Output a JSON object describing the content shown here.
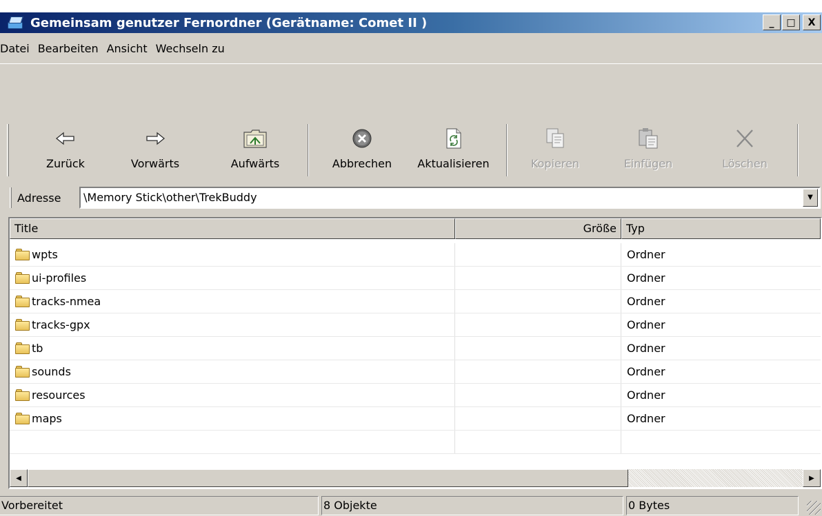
{
  "window": {
    "title": "Gemeinsam genutzer Fernordner (Gerätname: Comet II )",
    "buttons": {
      "minimize": "_",
      "maximize": "□",
      "close": "X"
    }
  },
  "menu": [
    "Datei",
    "Bearbeiten",
    "Ansicht",
    "Wechseln zu"
  ],
  "toolbar": {
    "back": "Zurück",
    "forward": "Vorwärts",
    "up": "Aufwärts",
    "stop": "Abbrechen",
    "refresh": "Aktualisieren",
    "copy": "Kopieren",
    "paste": "Einfügen",
    "delete": "Löschen"
  },
  "address": {
    "label": "Adresse",
    "value": "\\Memory Stick\\other\\TrekBuddy"
  },
  "list": {
    "columns": {
      "title": "Title",
      "size": "Größe",
      "type": "Typ"
    },
    "rows": [
      {
        "name": "wpts",
        "size": "",
        "type": "Ordner"
      },
      {
        "name": "ui-profiles",
        "size": "",
        "type": "Ordner"
      },
      {
        "name": "tracks-nmea",
        "size": "",
        "type": "Ordner"
      },
      {
        "name": "tracks-gpx",
        "size": "",
        "type": "Ordner"
      },
      {
        "name": "tb",
        "size": "",
        "type": "Ordner"
      },
      {
        "name": "sounds",
        "size": "",
        "type": "Ordner"
      },
      {
        "name": "resources",
        "size": "",
        "type": "Ordner"
      },
      {
        "name": "maps",
        "size": "",
        "type": "Ordner"
      }
    ]
  },
  "status": {
    "state": "Vorbereitet",
    "count": "8 Objekte",
    "bytes": "0 Bytes"
  },
  "colors": {
    "title_gradient_start": "#0a246a",
    "title_gradient_end": "#a6caf0",
    "chrome": "#d4d0c8"
  }
}
